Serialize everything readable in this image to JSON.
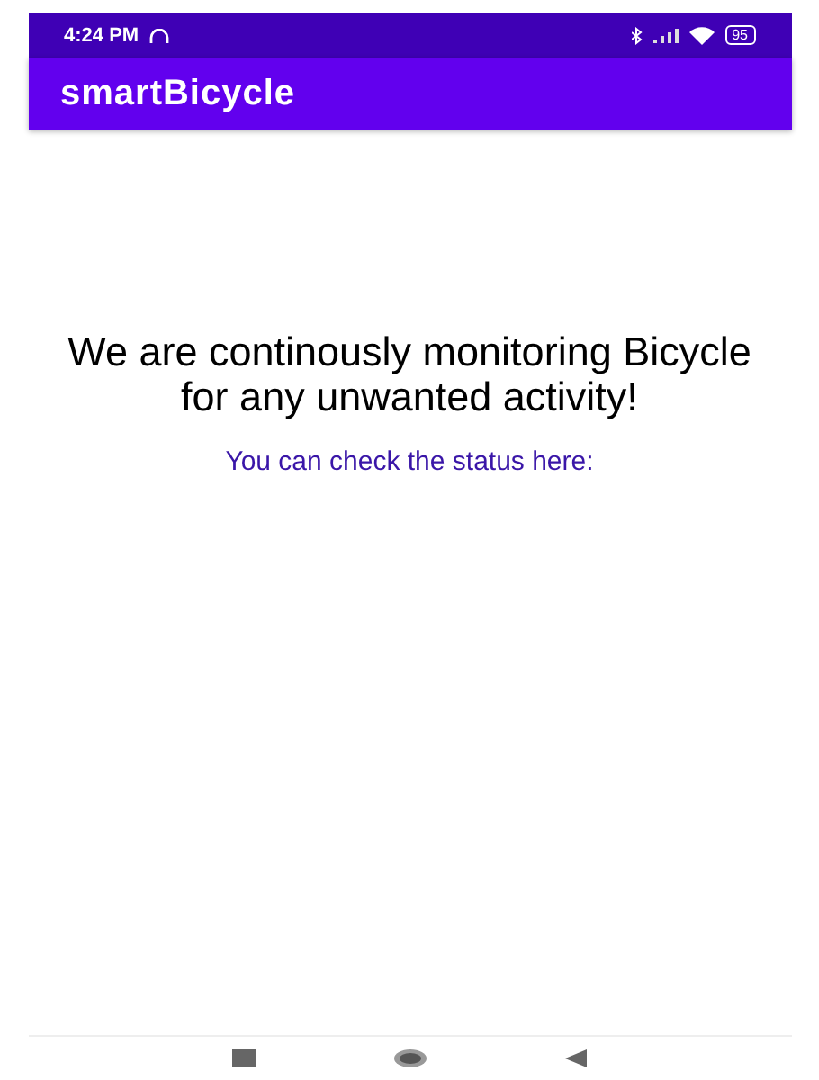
{
  "status_bar": {
    "time": "4:24 PM",
    "battery": "95"
  },
  "app_bar": {
    "title": "smartBicycle"
  },
  "content": {
    "headline": "We are continously monitoring Bicycle for any unwanted activity!",
    "status_prompt": "You can check the status here:"
  }
}
